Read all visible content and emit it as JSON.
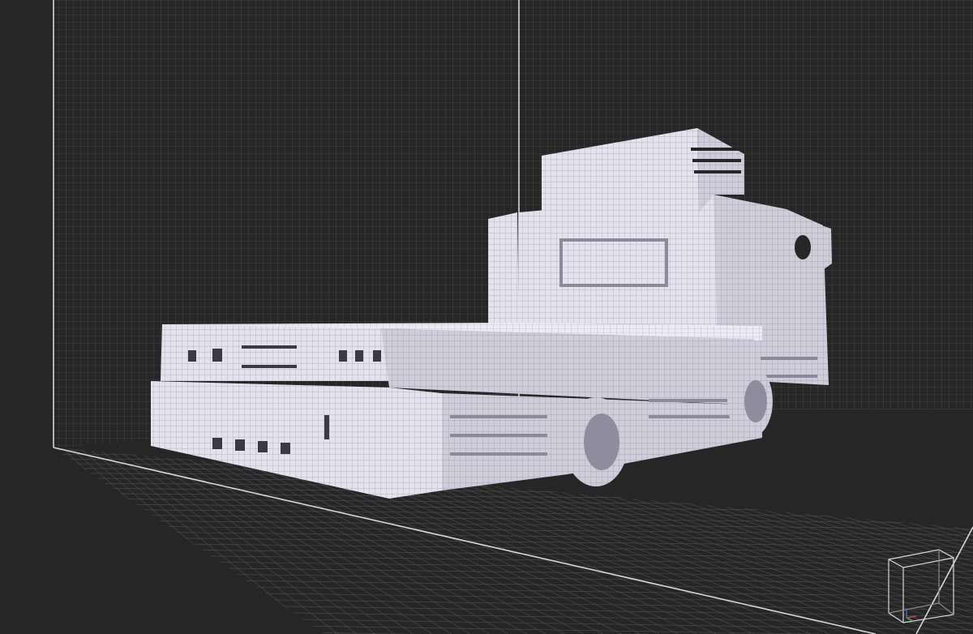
{
  "app": {
    "view": "voxel-3d-viewport",
    "model": "voxel-truck"
  },
  "colors": {
    "background": "#262626",
    "grid_line": "#5a5a5a",
    "grid_line_minor": "#444444",
    "bounding_edge": "#dcdcdc",
    "voxel_face_light": "#e6e4ee",
    "voxel_face_mid": "#d2d0dc",
    "voxel_face_shade": "#b9b7c6",
    "voxel_edge": "#9a98a8",
    "axis_x": "#d04040",
    "axis_y": "#40b040",
    "axis_z": "#4060d0"
  },
  "icons": {
    "orientation_gizmo": "view-cube-icon"
  }
}
